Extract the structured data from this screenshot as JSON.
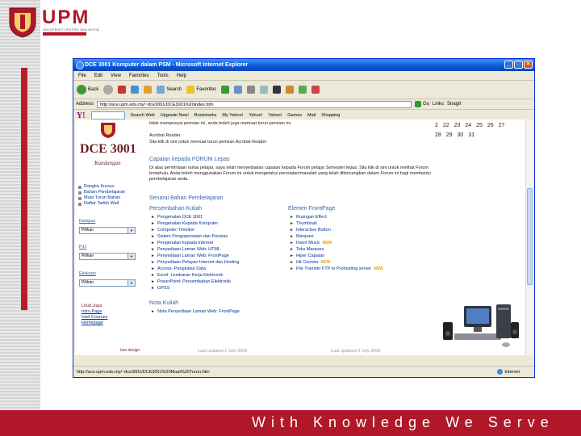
{
  "brand": {
    "logo_text": "UPM",
    "logo_subtitle": "UNIVERSITI PUTRA MALAYSIA",
    "slogan": "With Knowledge We Serve",
    "accent_color": "#b0182a"
  },
  "window": {
    "title": "DCE 3001 Komputer dalam PSM - Microsoft Internet Explorer",
    "menu": [
      "File",
      "Edit",
      "View",
      "Favorites",
      "Tools",
      "Help"
    ],
    "toolbar": {
      "back_label": "Back",
      "search_label": "Search",
      "favorites_label": "Favorites"
    },
    "address_label": "Address",
    "address_value": "http://ace.upm.edu.my/~dce3001/DCE3001%20index.htm",
    "go_label": "Go",
    "links_label": "Links",
    "snagit_label": "SnagIt",
    "yahoo_bar": {
      "search_web": "Search Web",
      "upgrade": "Upgrade Now!",
      "bookmarks": "Bookmarks",
      "my_yahoo": "My Yahoo!",
      "yahoo": "Yahoo!",
      "yahoo_bang": "Yahoo!",
      "games": "Games",
      "mail": "Mail",
      "shopping": "Shopping"
    },
    "status_url": "http://ace.upm.edu.my/~dce3001/DCE3001%20Muat%20Turun.htm",
    "status_zone": "Internet"
  },
  "page": {
    "course_code": "DCE 3001",
    "kandungan": "Kandungan",
    "nav_links": [
      "Rangka Kursus",
      "Bahan Pembelajaran",
      "Muat Turun Bahan",
      "Daftar Tarikh Wall"
    ],
    "dropdowns": [
      {
        "label": "Kampus",
        "value": "Pilihan"
      },
      {
        "label": "PJJ",
        "value": "Pilihan"
      },
      {
        "label": "Ekskursi",
        "value": "Pilihan"
      }
    ],
    "lihat_title": "Lihat Juga",
    "lihat_links": [
      "Intro Page",
      "Intel Courses",
      "Homepage"
    ],
    "design_credit": "bas design",
    "intro_text": "tidak mempunyai perisian ini, anda boleh juga memuat turun perisian ini.",
    "acrobat_heading": "Acrobat Reader",
    "acrobat_text": "Sila klik di sini untuk memuat turun perisian Acrobat Reader.",
    "capaian_heading": "Capaian kepada FORUM Lepas",
    "capaian_text": "Di atas permintaan ramai pelajar, saya telah menyediakan capaian kepada Forum pelajar Semester lepas. Sila klik di sini untuk melihat Forum terdahulu. Anda boleh menggunakan Forum ini untuk mengetahui persoalan/masalah yang telah dibincangkan dalam Forum ini bagi membantu pembelajaran anda.",
    "senarai_heading": "Senarai Bahan Pembelajaran",
    "persembahan_heading": "Persembahan Kuliah",
    "persembahan_items": [
      "Pengenalan DCE 3001",
      "Pengenalan Kepada Komputer",
      "Computer Timeline",
      "Sistem Pengoperasian dan Perisian",
      "Pengenalan kepada Internet",
      "Penyediaan Laman Web: HTML",
      "Penyediaan Laman Web: FrontPage",
      "Penyediaan Pelayan Internet dan Hosting",
      "Access: Pangkalan Data",
      "Excel: Lembaran Kerja Elektronik",
      "PowerPoint: Persembahan Elektronik",
      "GPSS"
    ],
    "elemen_heading": "Elemen FrontPage",
    "elemen_items": [
      {
        "text": "Ruangan Effect",
        "hot": false
      },
      {
        "text": "Thumbnail",
        "hot": false
      },
      {
        "text": "Interactive Button",
        "hot": false
      },
      {
        "text": "Marquee",
        "hot": false
      },
      {
        "text": "Insert Music",
        "hot": true
      },
      {
        "text": "Teks Marquee",
        "hot": false
      },
      {
        "text": "Hiper Capaian",
        "hot": false
      },
      {
        "text": "Hit Counter",
        "hot": true
      },
      {
        "text": "File Transfer FTP to Prohosting server",
        "hot": true
      }
    ],
    "hot_badge": "NEW",
    "nota_heading": "Nota Kuliah",
    "nota_items": [
      "Nota Penyediaan Laman Web: FrontPage"
    ],
    "calendar_rows": [
      [
        "22",
        "23",
        "24",
        "25",
        "26",
        "27"
      ],
      [
        "28",
        "29",
        "30",
        "31"
      ]
    ],
    "calendar_first": [
      "2",
      ""
    ],
    "footer_left": "Last updated 2 July 2006",
    "footer_right": "Last updated 2 July 2006"
  }
}
